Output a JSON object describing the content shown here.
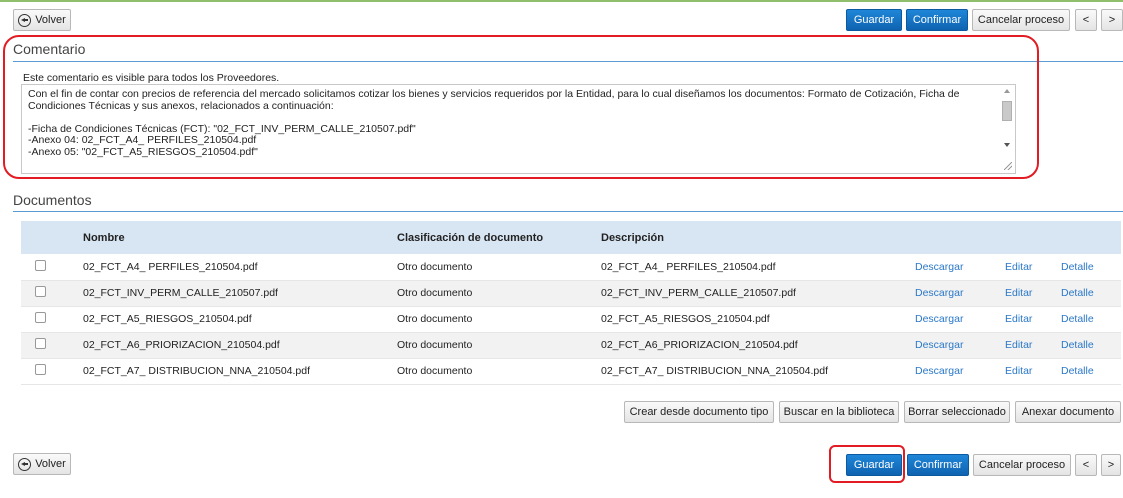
{
  "nav": {
    "back_label": "Volver",
    "save_label": "Guardar",
    "confirm_label": "Confirmar",
    "cancel_label": "Cancelar proceso",
    "prev_label": "<",
    "next_label": ">"
  },
  "comment": {
    "title": "Comentario",
    "note": "Este comentario es visible para todos los Proveedores.",
    "lines": [
      "Con el fin de contar con precios de referencia del mercado solicitamos cotizar los bienes y servicios requeridos por la Entidad, para lo cual diseñamos los documentos: Formato de Cotización, Ficha de",
      "Condiciones Técnicas y sus anexos, relacionados a continuación:",
      "",
      "-Ficha de Condiciones Técnicas (FCT): \"02_FCT_INV_PERM_CALLE_210507.pdf\"",
      "-Anexo 04: 02_FCT_A4_ PERFILES_210504.pdf",
      "-Anexo 05: \"02_FCT_A5_RIESGOS_210504.pdf\""
    ]
  },
  "documents": {
    "title": "Documentos",
    "columns": [
      "Nombre",
      "Clasificación de documento",
      "Descripción"
    ],
    "rows": [
      {
        "name": "02_FCT_A4_ PERFILES_210504.pdf",
        "classification": "Otro documento",
        "description": "02_FCT_A4_ PERFILES_210504.pdf"
      },
      {
        "name": "02_FCT_INV_PERM_CALLE_210507.pdf",
        "classification": "Otro documento",
        "description": "02_FCT_INV_PERM_CALLE_210507.pdf"
      },
      {
        "name": "02_FCT_A5_RIESGOS_210504.pdf",
        "classification": "Otro documento",
        "description": "02_FCT_A5_RIESGOS_210504.pdf"
      },
      {
        "name": "02_FCT_A6_PRIORIZACION_210504.pdf",
        "classification": "Otro documento",
        "description": "02_FCT_A6_PRIORIZACION_210504.pdf"
      },
      {
        "name": "02_FCT_A7_ DISTRIBUCION_NNA_210504.pdf",
        "classification": "Otro documento",
        "description": "02_FCT_A7_ DISTRIBUCION_NNA_210504.pdf"
      }
    ],
    "row_actions": {
      "download": "Descargar",
      "edit": "Editar",
      "detail": "Detalle"
    },
    "actions": {
      "create_from_template": "Crear desde documento tipo",
      "search_library": "Buscar en la biblioteca",
      "delete_selected": "Borrar seleccionado",
      "attach": "Anexar documento"
    }
  },
  "colors": {
    "primary": "#1477c9",
    "link": "#2a78c9",
    "highlight": "#e31b23",
    "header_bg": "#d8e6f3"
  }
}
